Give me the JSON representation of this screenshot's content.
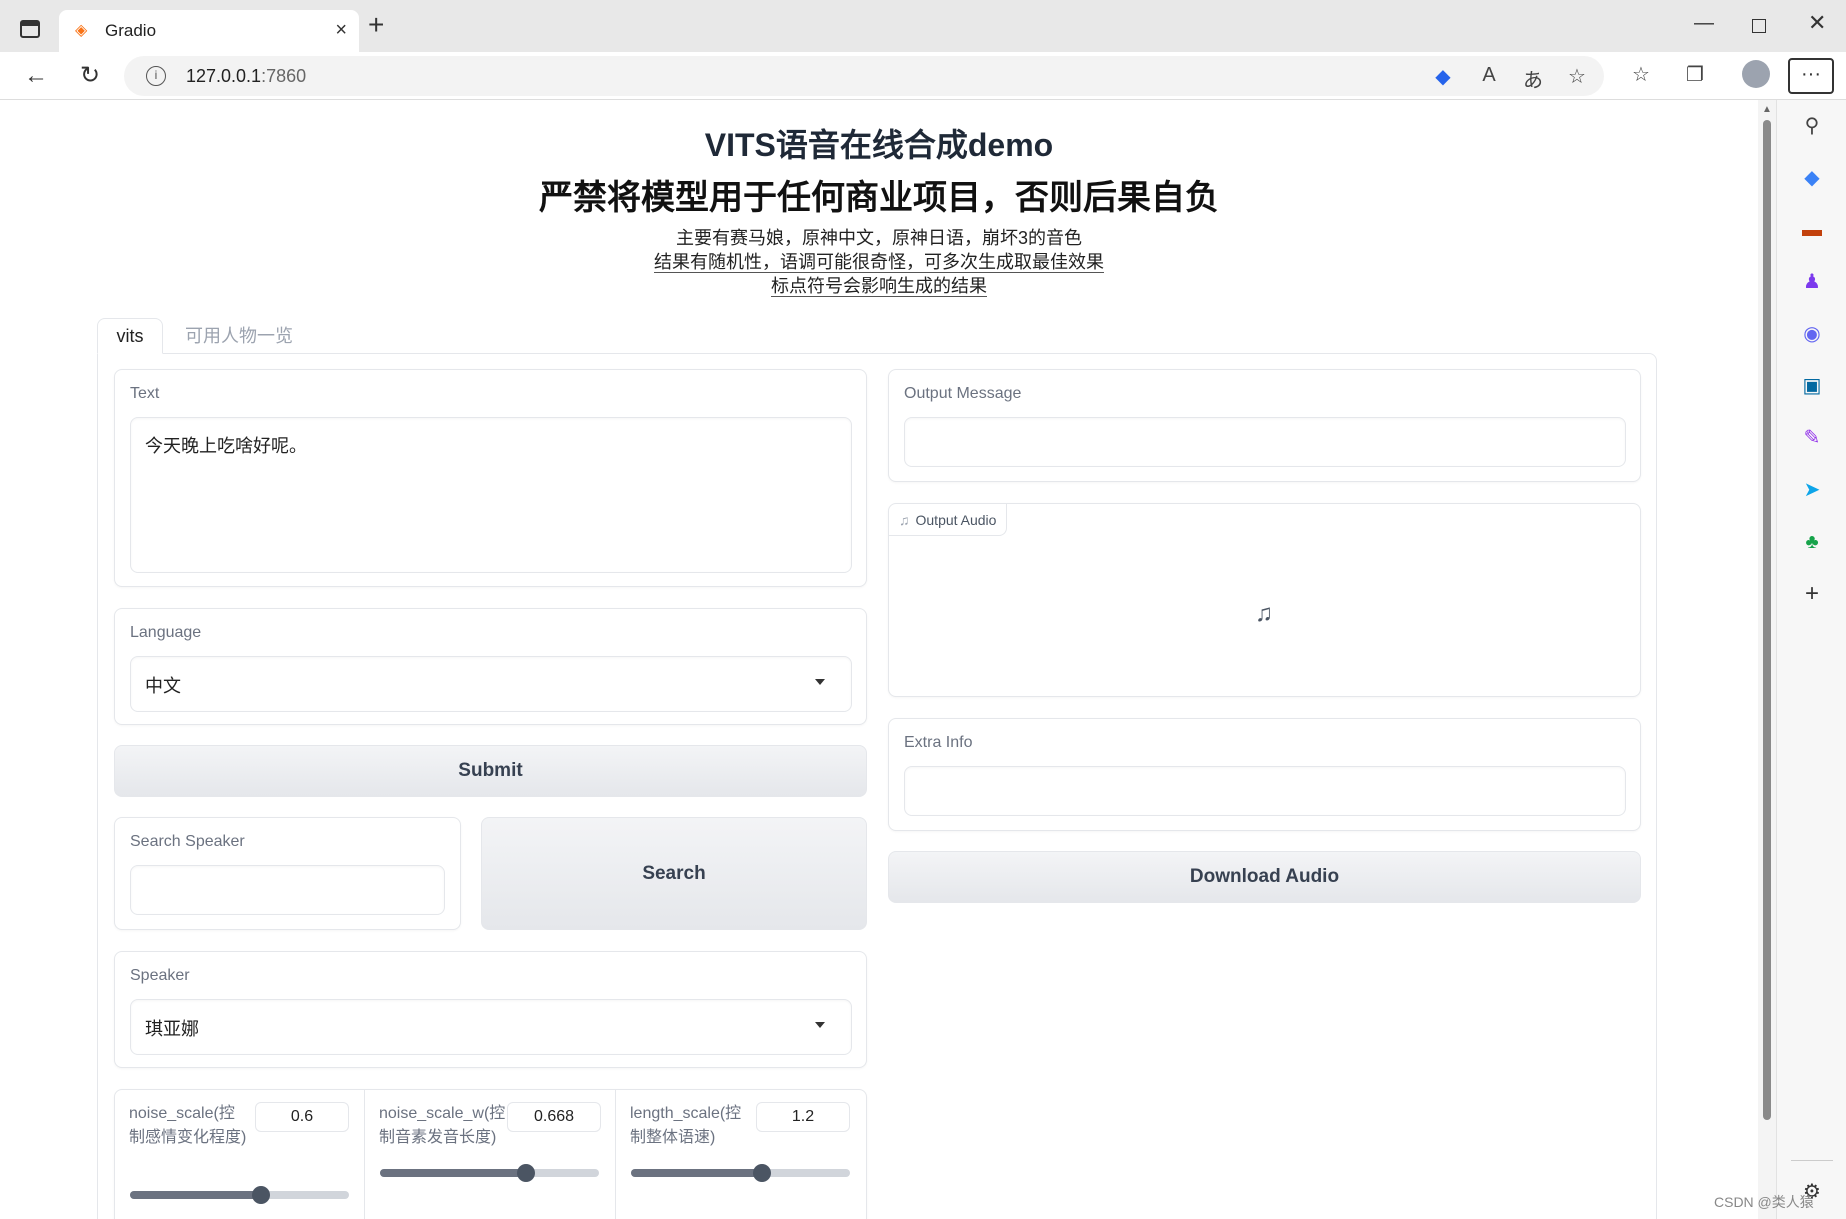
{
  "browser": {
    "tab_title": "Gradio",
    "url_host": "127.0.0.1",
    "url_port": ":7860",
    "icons": [
      "tab-actions-icon",
      "back-icon",
      "reload-icon",
      "info-icon",
      "shopping-tag-icon",
      "read-aloud-icon",
      "translate-icon",
      "favorite-add-icon",
      "favorites-icon",
      "collections-icon",
      "profile-icon",
      "more-icon"
    ],
    "sidebar_icons": [
      "search-icon",
      "shopping-icon",
      "tools-icon",
      "games-icon",
      "office-icon",
      "outlook-icon",
      "designer-icon",
      "send-icon",
      "tree-icon",
      "add-icon",
      "settings-icon"
    ]
  },
  "page": {
    "title1": "VITS语音在线合成demo",
    "title2": "严禁将模型用于任何商业项目，否则后果自负",
    "desc1": "主要有赛马娘，原神中文，原神日语，崩坏3的音色",
    "desc2": "结果有随机性，语调可能很奇怪，可多次生成取最佳效果",
    "desc3": "标点符号会影响生成的结果"
  },
  "tabs": [
    {
      "label": "vits",
      "active": true
    },
    {
      "label": "可用人物一览",
      "active": false
    }
  ],
  "left": {
    "text_label": "Text",
    "text_value": "今天晚上吃啥好呢。",
    "language_label": "Language",
    "language_value": "中文",
    "submit_label": "Submit",
    "search_speaker_label": "Search Speaker",
    "search_speaker_value": "",
    "search_label": "Search",
    "speaker_label": "Speaker",
    "speaker_value": "琪亚娜"
  },
  "sliders": [
    {
      "label": "noise_scale(控制感情变化程度)",
      "value": "0.6",
      "fraction": 0.6
    },
    {
      "label": "noise_scale_w(控制音素发音长度)",
      "value": "0.668",
      "fraction": 0.668
    },
    {
      "label": "length_scale(控制整体语速)",
      "value": "1.2",
      "fraction": 0.6
    }
  ],
  "right": {
    "output_message_label": "Output Message",
    "output_message_value": "",
    "output_audio_label": "Output Audio",
    "extra_info_label": "Extra Info",
    "extra_info_value": "",
    "download_label": "Download Audio"
  },
  "watermark": "CSDN @类人猿"
}
